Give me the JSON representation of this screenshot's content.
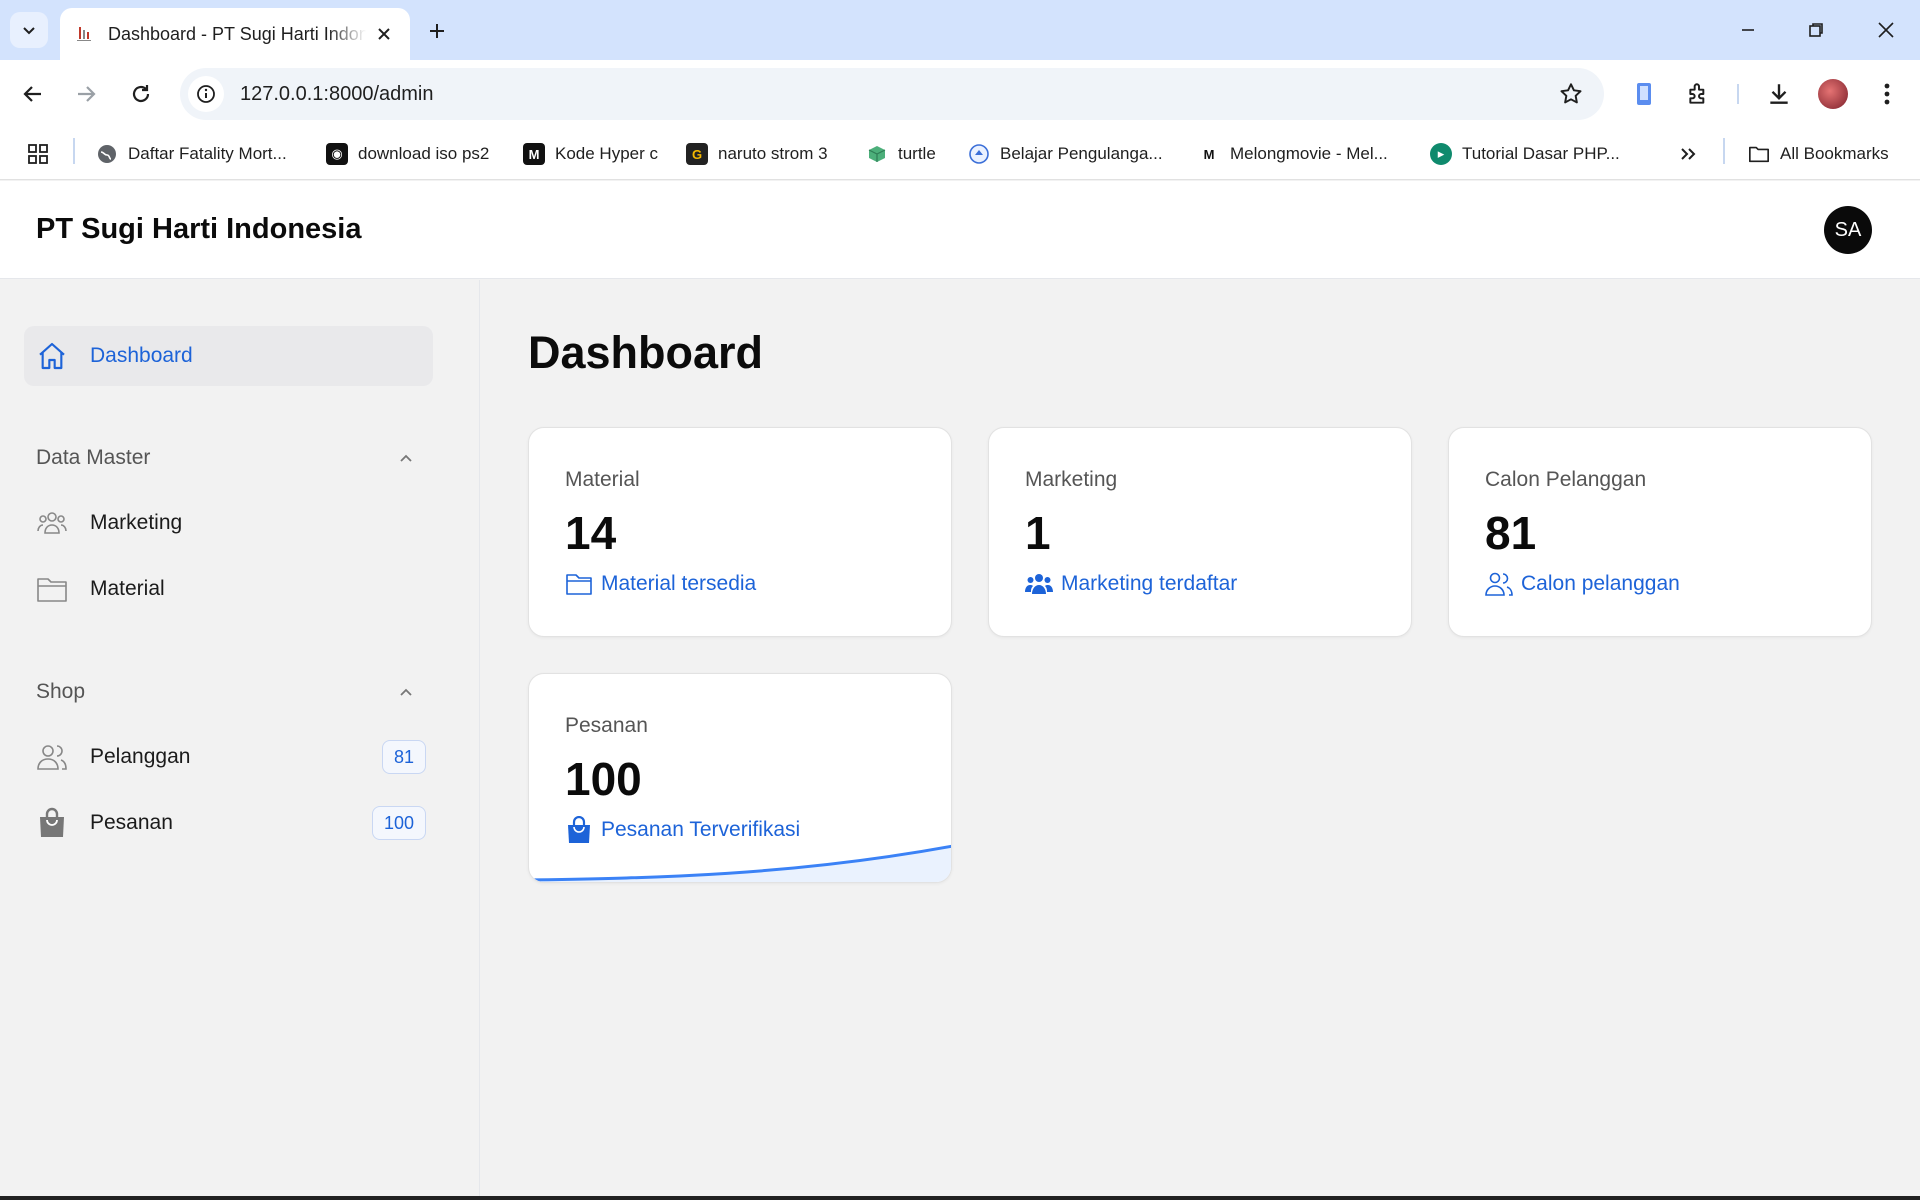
{
  "browser": {
    "tab_title": "Dashboard - PT Sugi Harti Indonesia",
    "url": "127.0.0.1:8000/admin",
    "bookmarks": [
      {
        "label": "Daftar Fatality Mort...",
        "icon": "globe-icon"
      },
      {
        "label": "download iso ps2",
        "icon": "site-icon"
      },
      {
        "label": "Kode Hyper c",
        "icon": "m-logo-icon"
      },
      {
        "label": "naruto  strom 3",
        "icon": "g-logo-icon"
      },
      {
        "label": "turtle",
        "icon": "cube-icon"
      },
      {
        "label": "Belajar Pengulanga...",
        "icon": "badge-icon"
      },
      {
        "label": "Melongmovie - Mel...",
        "icon": "m-logo-icon"
      },
      {
        "label": "Tutorial Dasar PHP...",
        "icon": "circle-logo-icon"
      }
    ],
    "all_bookmarks_label": "All Bookmarks"
  },
  "app": {
    "brand": "PT Sugi Harti Indonesia",
    "avatar_initials": "SA"
  },
  "sidebar": {
    "active_item": {
      "label": "Dashboard",
      "icon": "home-icon"
    },
    "groups": [
      {
        "title": "Data Master",
        "items": [
          {
            "label": "Marketing",
            "icon": "users-group-icon"
          },
          {
            "label": "Material",
            "icon": "folder-icon"
          }
        ]
      },
      {
        "title": "Shop",
        "items": [
          {
            "label": "Pelanggan",
            "icon": "users-icon",
            "badge": "81"
          },
          {
            "label": "Pesanan",
            "icon": "shopping-bag-icon",
            "badge": "100"
          }
        ]
      }
    ]
  },
  "main": {
    "title": "Dashboard",
    "stats": [
      {
        "label": "Material",
        "value": "14",
        "description": "Material tersedia",
        "icon": "folder-icon"
      },
      {
        "label": "Marketing",
        "value": "1",
        "description": "Marketing terdaftar",
        "icon": "users-group-icon"
      },
      {
        "label": "Calon Pelanggan",
        "value": "81",
        "description": "Calon pelanggan",
        "icon": "users-icon"
      },
      {
        "label": "Pesanan",
        "value": "100",
        "description": "Pesanan Terverifikasi",
        "icon": "shopping-bag-icon"
      }
    ]
  },
  "colors": {
    "accent": "#1d63d8",
    "tabbar": "#d3e3fd",
    "sidebar_bg": "#f2f2f2"
  }
}
